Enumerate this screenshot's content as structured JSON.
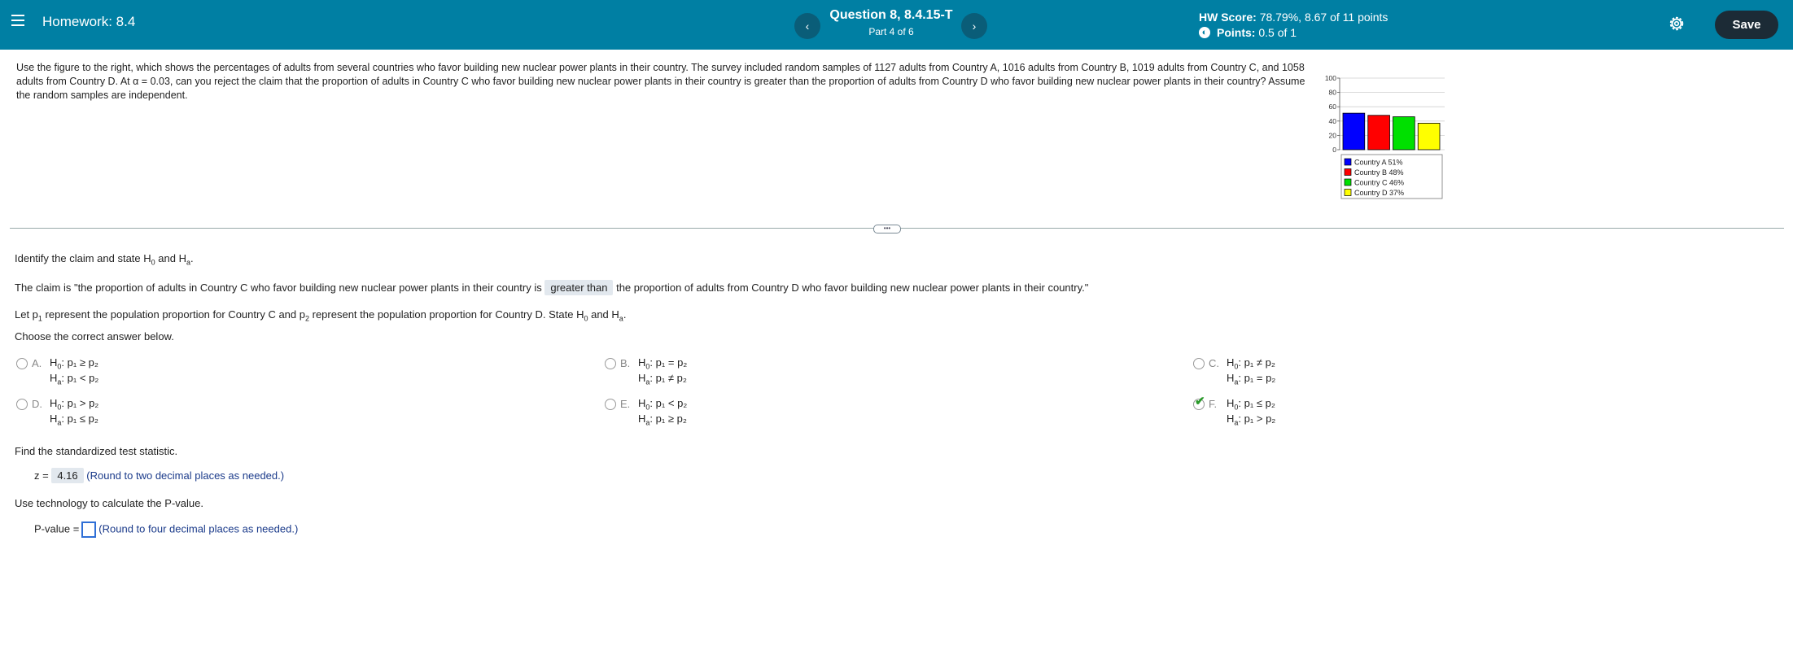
{
  "header": {
    "title": "Homework: 8.4",
    "question_title": "Question 8, 8.4.15-T",
    "question_part": "Part 4 of 6",
    "hw_score_label": "HW Score:",
    "hw_score_value": "78.79%, 8.67 of 11 points",
    "points_label": "Points:",
    "points_value": "0.5 of 1",
    "save_label": "Save",
    "prev_icon": "‹",
    "next_icon": "›"
  },
  "question_text": "Use the figure to the right, which shows the percentages of adults from several countries who favor building new nuclear power plants in their country. The survey included random samples of 1127 adults from Country A, 1016 adults from Country B, 1019 adults from Country C, and 1058 adults from Country D. At α = 0.03, can you reject the claim that the proportion of adults in Country C who favor building new nuclear power plants in their country is greater than the proportion of adults from Country D who favor building new nuclear power plants in their country? Assume the random samples are independent.",
  "chart_data": {
    "type": "bar",
    "categories": [
      "Country A 51%",
      "Country B 48%",
      "Country C 46%",
      "Country D 37%"
    ],
    "values": [
      51,
      48,
      46,
      37
    ],
    "colors": [
      "#0000ff",
      "#ff0000",
      "#00e000",
      "#ffff00"
    ],
    "yticks": [
      "100",
      "80",
      "60",
      "40",
      "20",
      "0"
    ],
    "ylim": [
      0,
      100
    ],
    "grid": true,
    "legend": "bottom"
  },
  "divider_handle": "•••",
  "identify": {
    "pre": "Identify the claim and state H",
    "mid": " and H",
    "post": "."
  },
  "claim": {
    "pre": "The claim is \"the proportion of adults in Country C who favor building new nuclear power plants in their country is",
    "answer": "greater than",
    "post": "the proportion of adults from Country D who favor building new nuclear power plants in their country.\""
  },
  "let_line": {
    "a": "Let p",
    "b": " represent the population proportion for Country C and p",
    "c": " represent the population proportion for Country D. State H",
    "d": " and H",
    "e": "."
  },
  "choose": "Choose the correct answer below.",
  "options": [
    {
      "letter": "A.",
      "h0": "p₁ ≥ p₂",
      "ha": "p₁ < p₂"
    },
    {
      "letter": "B.",
      "h0": "p₁ = p₂",
      "ha": "p₁ ≠ p₂"
    },
    {
      "letter": "C.",
      "h0": "p₁ ≠ p₂",
      "ha": "p₁ = p₂"
    },
    {
      "letter": "D.",
      "h0": "p₁ > p₂",
      "ha": "p₁ ≤ p₂"
    },
    {
      "letter": "E.",
      "h0": "p₁ < p₂",
      "ha": "p₁ ≥ p₂"
    },
    {
      "letter": "F.",
      "h0": "p₁ ≤ p₂",
      "ha": "p₁ > p₂"
    }
  ],
  "h0_label": "H",
  "ha_label": "H",
  "find_stat": "Find the standardized test statistic.",
  "z_label": "z =",
  "z_value": "4.16",
  "z_hint": "(Round to two decimal places as needed.)",
  "use_tech": "Use technology to calculate the P-value.",
  "pvalue_label": "P-value =",
  "pvalue_hint": "(Round to four decimal places as needed.)"
}
